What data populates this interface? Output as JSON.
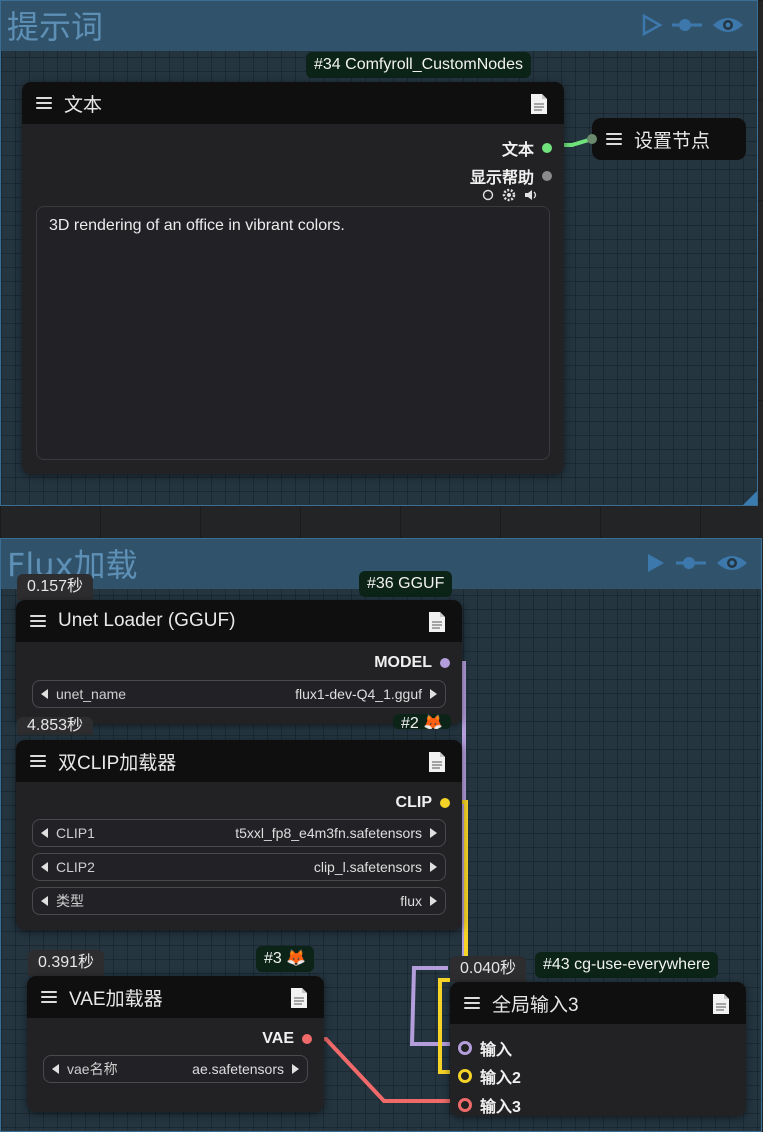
{
  "groups": {
    "prompt": {
      "title": "提示词"
    },
    "flux": {
      "title": "Flux加载"
    }
  },
  "group_icons": [
    "play-icon",
    "pin-icon",
    "eye-icon"
  ],
  "nodes": {
    "text": {
      "badge": "#34 Comfyroll_CustomNodes",
      "title": "文本",
      "outputs": [
        {
          "label": "文本",
          "color": "#6fe27b"
        },
        {
          "label": "显示帮助",
          "color": "#8a8a8a"
        }
      ],
      "textarea": "3D rendering of an office in vibrant colors."
    },
    "set_node": {
      "title": "设置节点"
    },
    "unet": {
      "timer": "0.157秒",
      "badge": "#36 GGUF",
      "title": "Unet Loader (GGUF)",
      "output": {
        "label": "MODEL",
        "color": "#b39ddb"
      },
      "widgets": [
        {
          "name": "unet_name",
          "value": "flux1-dev-Q4_1.gguf"
        }
      ]
    },
    "dualclip": {
      "timer": "4.853秒",
      "badge": "#2 🦊",
      "title": "双CLIP加载器",
      "output": {
        "label": "CLIP",
        "color": "#f5d327"
      },
      "widgets": [
        {
          "name": "CLIP1",
          "value": "t5xxl_fp8_e4m3fn.safetensors"
        },
        {
          "name": "CLIP2",
          "value": "clip_l.safetensors"
        },
        {
          "name": "类型",
          "value": "flux"
        }
      ]
    },
    "vae": {
      "timer": "0.391秒",
      "badge": "#3 🦊",
      "title": "VAE加载器",
      "output": {
        "label": "VAE",
        "color": "#f06a6a"
      },
      "widgets": [
        {
          "name": "vae名称",
          "value": "ae.safetensors"
        }
      ]
    },
    "everywhere": {
      "timer": "0.040秒",
      "badge": "#43 cg-use-everywhere",
      "title": "全局输入3",
      "inputs": [
        {
          "label": "输入",
          "color": "#b39ddb"
        },
        {
          "label": "输入2",
          "color": "#f5d327"
        },
        {
          "label": "输入3",
          "color": "#f06a6a"
        }
      ]
    }
  }
}
